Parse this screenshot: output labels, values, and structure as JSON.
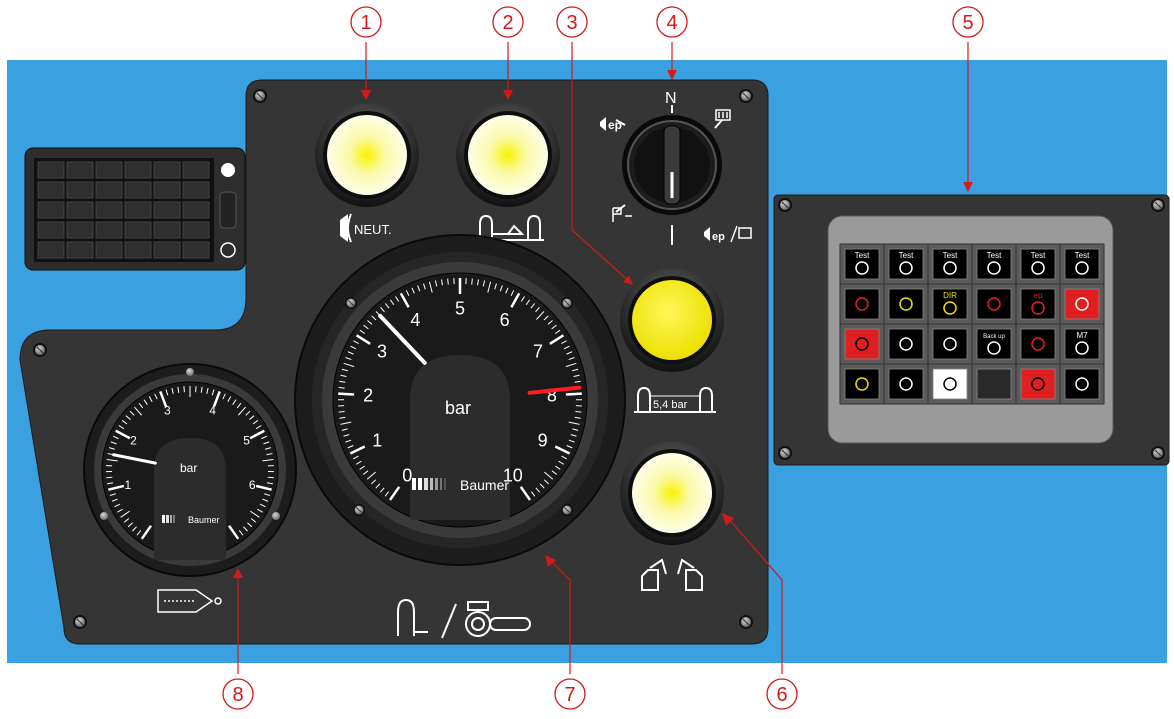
{
  "callouts": [
    {
      "number": "1"
    },
    {
      "number": "2"
    },
    {
      "number": "3"
    },
    {
      "number": "4"
    },
    {
      "number": "5"
    },
    {
      "number": "6"
    },
    {
      "number": "7"
    },
    {
      "number": "8"
    }
  ],
  "labels": {
    "neutral_lamp": "NEUT.",
    "mode_switch_n": "N",
    "mode_switch_ep": "ep",
    "pressure_lamp": "5,4 bar"
  },
  "big_gauge": {
    "unit": "bar",
    "brand": "Baumer",
    "ticks": [
      "0",
      "1",
      "2",
      "3",
      "4",
      "5",
      "6",
      "7",
      "8",
      "9",
      "10"
    ],
    "needle_value": 3.5,
    "red_mark_value": 7.9,
    "range": [
      0,
      10
    ]
  },
  "small_gauge": {
    "unit": "bar",
    "brand": "Baumer",
    "ticks": [
      "1",
      "2",
      "3",
      "4",
      "5",
      "6"
    ],
    "needle_value": 1.6,
    "range": [
      0,
      7
    ]
  },
  "indicator_grid": {
    "cells": [
      {
        "text": "Test",
        "bg": "#000000",
        "fg": "#ffffff"
      },
      {
        "text": "Test",
        "bg": "#000000",
        "fg": "#ffffff"
      },
      {
        "text": "Test",
        "bg": "#000000",
        "fg": "#ffffff"
      },
      {
        "text": "Test",
        "bg": "#000000",
        "fg": "#ffffff"
      },
      {
        "text": "Test",
        "bg": "#000000",
        "fg": "#ffffff"
      },
      {
        "text": "Test",
        "bg": "#000000",
        "fg": "#ffffff"
      },
      {
        "text": "",
        "bg": "#000000",
        "fg": "#e02020"
      },
      {
        "text": "",
        "bg": "#000000",
        "fg": "#f0e000"
      },
      {
        "text": "DIR",
        "bg": "#000000",
        "fg": "#f0e000"
      },
      {
        "text": "",
        "bg": "#000000",
        "fg": "#e02020"
      },
      {
        "text": "ep",
        "bg": "#000000",
        "fg": "#e02020"
      },
      {
        "text": "",
        "bg": "#e02020",
        "fg": "#ffffff"
      },
      {
        "text": "",
        "bg": "#e02020",
        "fg": "#000000"
      },
      {
        "text": "",
        "bg": "#000000",
        "fg": "#ffffff"
      },
      {
        "text": "",
        "bg": "#000000",
        "fg": "#ffffff"
      },
      {
        "text": "Back up",
        "bg": "#000000",
        "fg": "#ffffff"
      },
      {
        "text": "",
        "bg": "#000000",
        "fg": "#e02020"
      },
      {
        "text": "M7",
        "bg": "#000000",
        "fg": "#ffffff"
      },
      {
        "text": "",
        "bg": "#000000",
        "fg": "#f0e000"
      },
      {
        "text": "",
        "bg": "#000000",
        "fg": "#ffffff"
      },
      {
        "text": "",
        "bg": "#ffffff",
        "fg": "#000000"
      },
      {
        "text": "",
        "bg": "#2a2a2a",
        "fg": "#2a2a2a"
      },
      {
        "text": "",
        "bg": "#e02020",
        "fg": "#000000"
      },
      {
        "text": "",
        "bg": "#000000",
        "fg": "#ffffff"
      }
    ]
  },
  "colors": {
    "background_blue": "#3aa0df",
    "panel": "#353535",
    "callout_red": "#d21a1a",
    "lamp_yellow": "#f5ea1e"
  }
}
